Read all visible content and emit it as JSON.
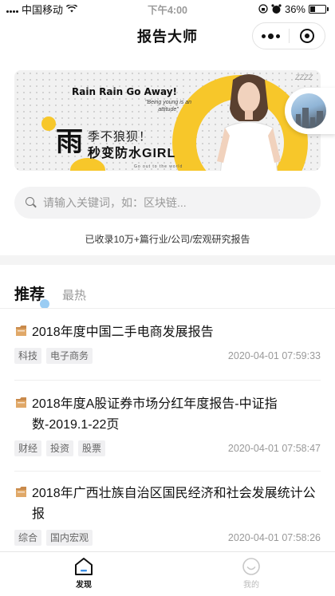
{
  "status_bar": {
    "carrier": "中国移动",
    "time": "下午4:00",
    "battery_pct_text": "36%",
    "battery_level": 0.36
  },
  "nav": {
    "title": "报告大师"
  },
  "banner": {
    "headline": "Rain Rain Go Away!",
    "quote": "\"Being young is an attitude\"",
    "big_char": "雨",
    "line1": "季不狼狈！",
    "line2": "秒变防水GIRL",
    "small_line": "Go out   to   the   world",
    "corner_tag": "ZZZZ"
  },
  "search": {
    "placeholder": "请输入关键词，如：区块链..."
  },
  "stat_text": "已收录10万+篇行业/公司/宏观研究报告",
  "tabs": {
    "active": "推荐",
    "other": "最热"
  },
  "reports": [
    {
      "title": "2018年度中国二手电商发展报告",
      "tags": [
        "科技",
        "电子商务"
      ],
      "time": "2020-04-01 07:59:33"
    },
    {
      "title": "2018年度A股证券市场分红年度报告-中证指数-2019.1-22页",
      "tags": [
        "财经",
        "投资",
        "股票"
      ],
      "time": "2020-04-01 07:58:47"
    },
    {
      "title": "2018年广西壮族自治区国民经济和社会发展统计公报",
      "tags": [
        "综合",
        "国内宏观"
      ],
      "time": "2020-04-01 07:58:26"
    }
  ],
  "tabbar": {
    "discover": "发现",
    "mine": "我的"
  },
  "icons": {
    "status": [
      "signal-icon",
      "wifi-icon",
      "lock-rotation-icon",
      "alarm-icon",
      "battery-icon"
    ],
    "nav": [
      "more-icon",
      "close-mini-program-icon"
    ],
    "list": "document-icon",
    "tabbar": [
      "discover-icon",
      "mine-icon"
    ]
  },
  "colors": {
    "accent_yellow": "#f7c72a",
    "tag_bg": "#f0f0f2",
    "muted": "#999999"
  }
}
